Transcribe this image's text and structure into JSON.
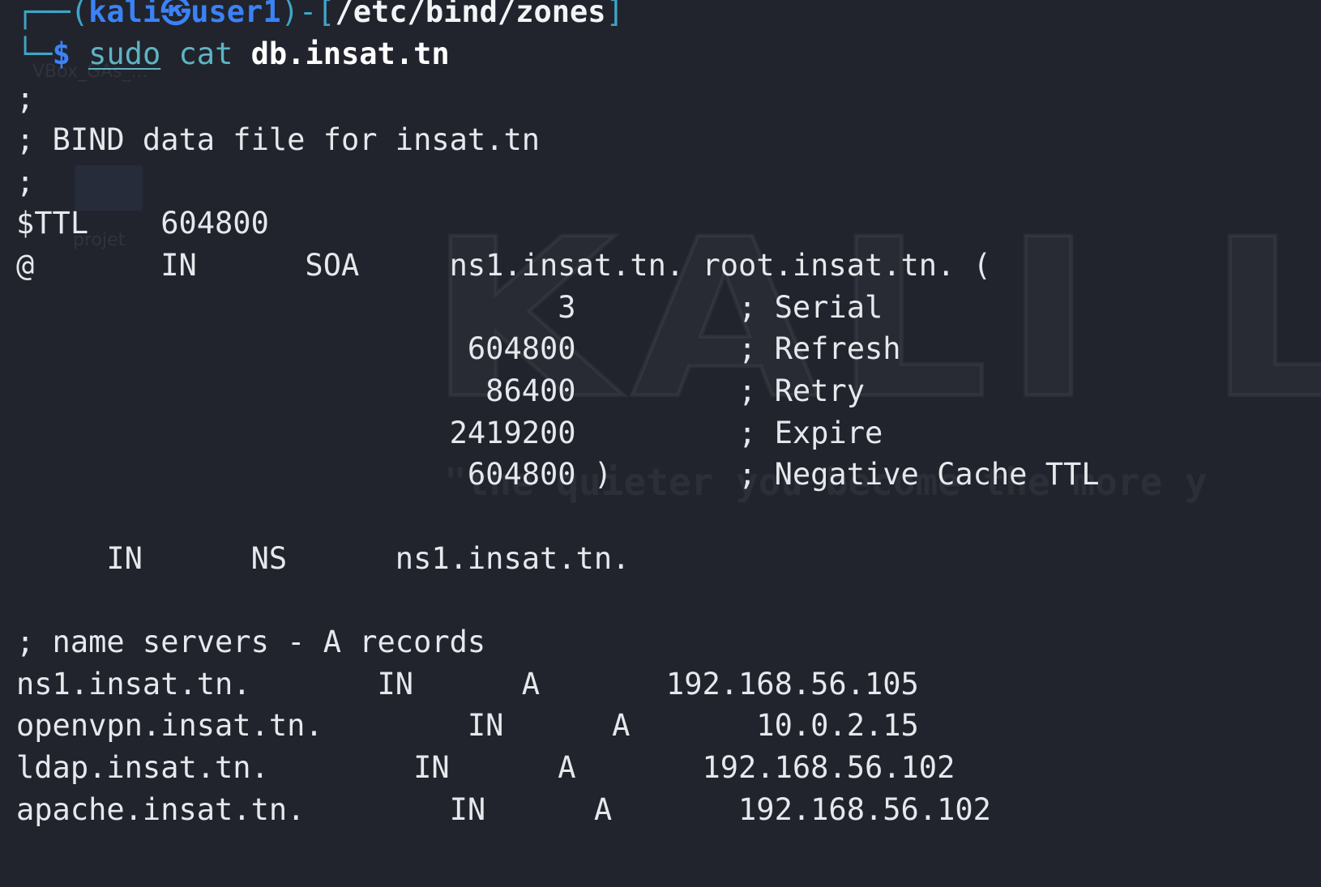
{
  "desktop": {
    "watermark": "KALI LI",
    "motto": "\"the quieter you become the more y",
    "labels": [
      "VBox_GAs_...",
      "projet"
    ]
  },
  "prompt": {
    "user": "kali",
    "separator": "㉿",
    "host": "user1",
    "path": "/etc/bind/zones",
    "symbol": "$",
    "command": "sudo",
    "program": "cat",
    "argument": "db.insat.tn"
  },
  "zone_file": {
    "lines": [
      ";",
      "; BIND data file for insat.tn",
      ";",
      "$TTL    604800",
      "@       IN      SOA     ns1.insat.tn. root.insat.tn. (",
      "                              3         ; Serial",
      "                         604800         ; Refresh",
      "                          86400         ; Retry",
      "                        2419200         ; Expire",
      "                         604800 )       ; Negative Cache TTL",
      "",
      "     IN      NS      ns1.insat.tn.",
      "",
      "; name servers - A records",
      "ns1.insat.tn.       IN      A       192.168.56.105",
      "openvpn.insat.tn.        IN      A       10.0.2.15",
      "ldap.insat.tn.        IN      A       192.168.56.102",
      "apache.insat.tn.        IN      A       192.168.56.102"
    ]
  },
  "colors": {
    "background": "#21242d",
    "text": "#e7e8ec",
    "user_host": "#3b82f6",
    "frame": "#3fa5c8",
    "command": "#5eb4c4"
  }
}
